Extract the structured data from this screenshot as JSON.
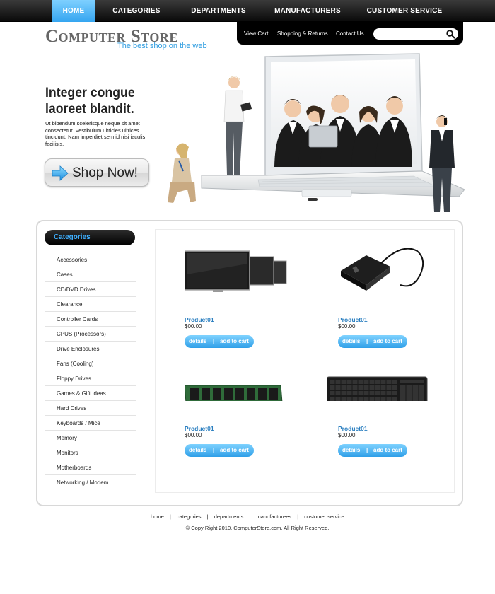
{
  "nav": {
    "items": [
      {
        "label": "HOME",
        "active": true
      },
      {
        "label": "CATEGORIES"
      },
      {
        "label": "DEPARTMENTS"
      },
      {
        "label": "MANUFACTURERS"
      },
      {
        "label": "CUSTOMER SERVICE"
      }
    ]
  },
  "header": {
    "logo_title": "Computer Store",
    "tagline": "The best shop on the web",
    "util_links": [
      "View Cart",
      "Shopping & Returns",
      "Contact Us"
    ],
    "separator": "|",
    "search": {
      "value": "",
      "placeholder": ""
    }
  },
  "hero": {
    "heading": "Integer congue laoreet blandit.",
    "body": "Ut bibendum scelerisque neque sit amet consectetur. Vestibulum ultricies ultrices tincidunt. Nam imperdiet sem id nisi iaculis facilisis.",
    "cta_label": "Shop Now!"
  },
  "sidebar": {
    "title": "Categories",
    "items": [
      "Accessories",
      "Cases",
      "CD/DVD Drives",
      "Clearance",
      "Controller Cards",
      "CPUS (Processors)",
      "Drive Enclosures",
      "Fans (Cooling)",
      "Floppy Drives",
      "Games & Gift Ideas",
      "Hard Drives",
      "Keyboards / Mice",
      "Memory",
      "Monitors",
      "Motherboards",
      "Networking / Modem"
    ]
  },
  "products": [
    {
      "name": "Product01",
      "price": "$00.00",
      "image": "monitors-icon",
      "details": "details",
      "add": "add to cart",
      "sep": "|"
    },
    {
      "name": "Product01",
      "price": "$00.00",
      "image": "external-drive-icon",
      "details": "details",
      "add": "add to cart",
      "sep": "|"
    },
    {
      "name": "Product01",
      "price": "$00.00",
      "image": "memory-module-icon",
      "details": "details",
      "add": "add to cart",
      "sep": "|"
    },
    {
      "name": "Product01",
      "price": "$00.00",
      "image": "keyboard-icon",
      "details": "details",
      "add": "add to cart",
      "sep": "|"
    }
  ],
  "footer": {
    "links": [
      "home",
      "categories",
      "departments",
      "manufacturees",
      "customer service"
    ],
    "separator": "|",
    "copyright": "© Copy Right 2010. ComputerStore.com. All Right Reserved."
  },
  "colors": {
    "accent": "#35a5f0",
    "nav_bg": "#0a0a0a",
    "link_blue": "#2b7fc0"
  }
}
